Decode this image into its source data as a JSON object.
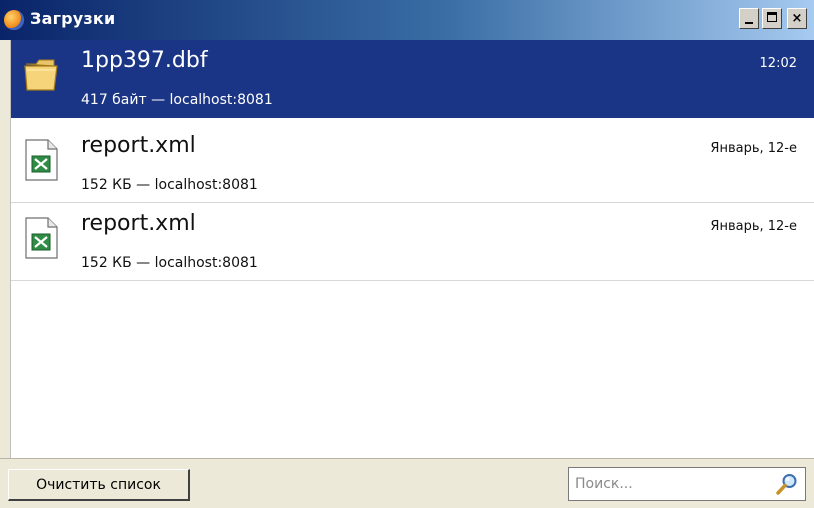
{
  "window": {
    "title": "Загрузки",
    "app_icon": "firefox-icon",
    "controls": [
      "minimize-icon",
      "maximize-icon",
      "close-icon"
    ],
    "close_glyph": "×"
  },
  "downloads": [
    {
      "name": "1pp397.dbf",
      "detail": "417 байт — localhost:8081",
      "time": "12:02",
      "icon": "folder-icon",
      "selected": true
    },
    {
      "name": "report.xml",
      "detail": "152 КБ — localhost:8081",
      "time": "Январь, 12-е",
      "icon": "excel-file-icon",
      "selected": false
    },
    {
      "name": "report.xml",
      "detail": "152 КБ — localhost:8081",
      "time": "Январь, 12-е",
      "icon": "excel-file-icon",
      "selected": false
    }
  ],
  "footer": {
    "clear_label": "Очистить список",
    "search_placeholder": "Поиск...",
    "search_icon": "magnifier-icon"
  },
  "colors": {
    "selection": "#1a3585",
    "titlebar_start": "#0a246a",
    "titlebar_end": "#a6caf0",
    "excel_green": "#1f7a34"
  }
}
